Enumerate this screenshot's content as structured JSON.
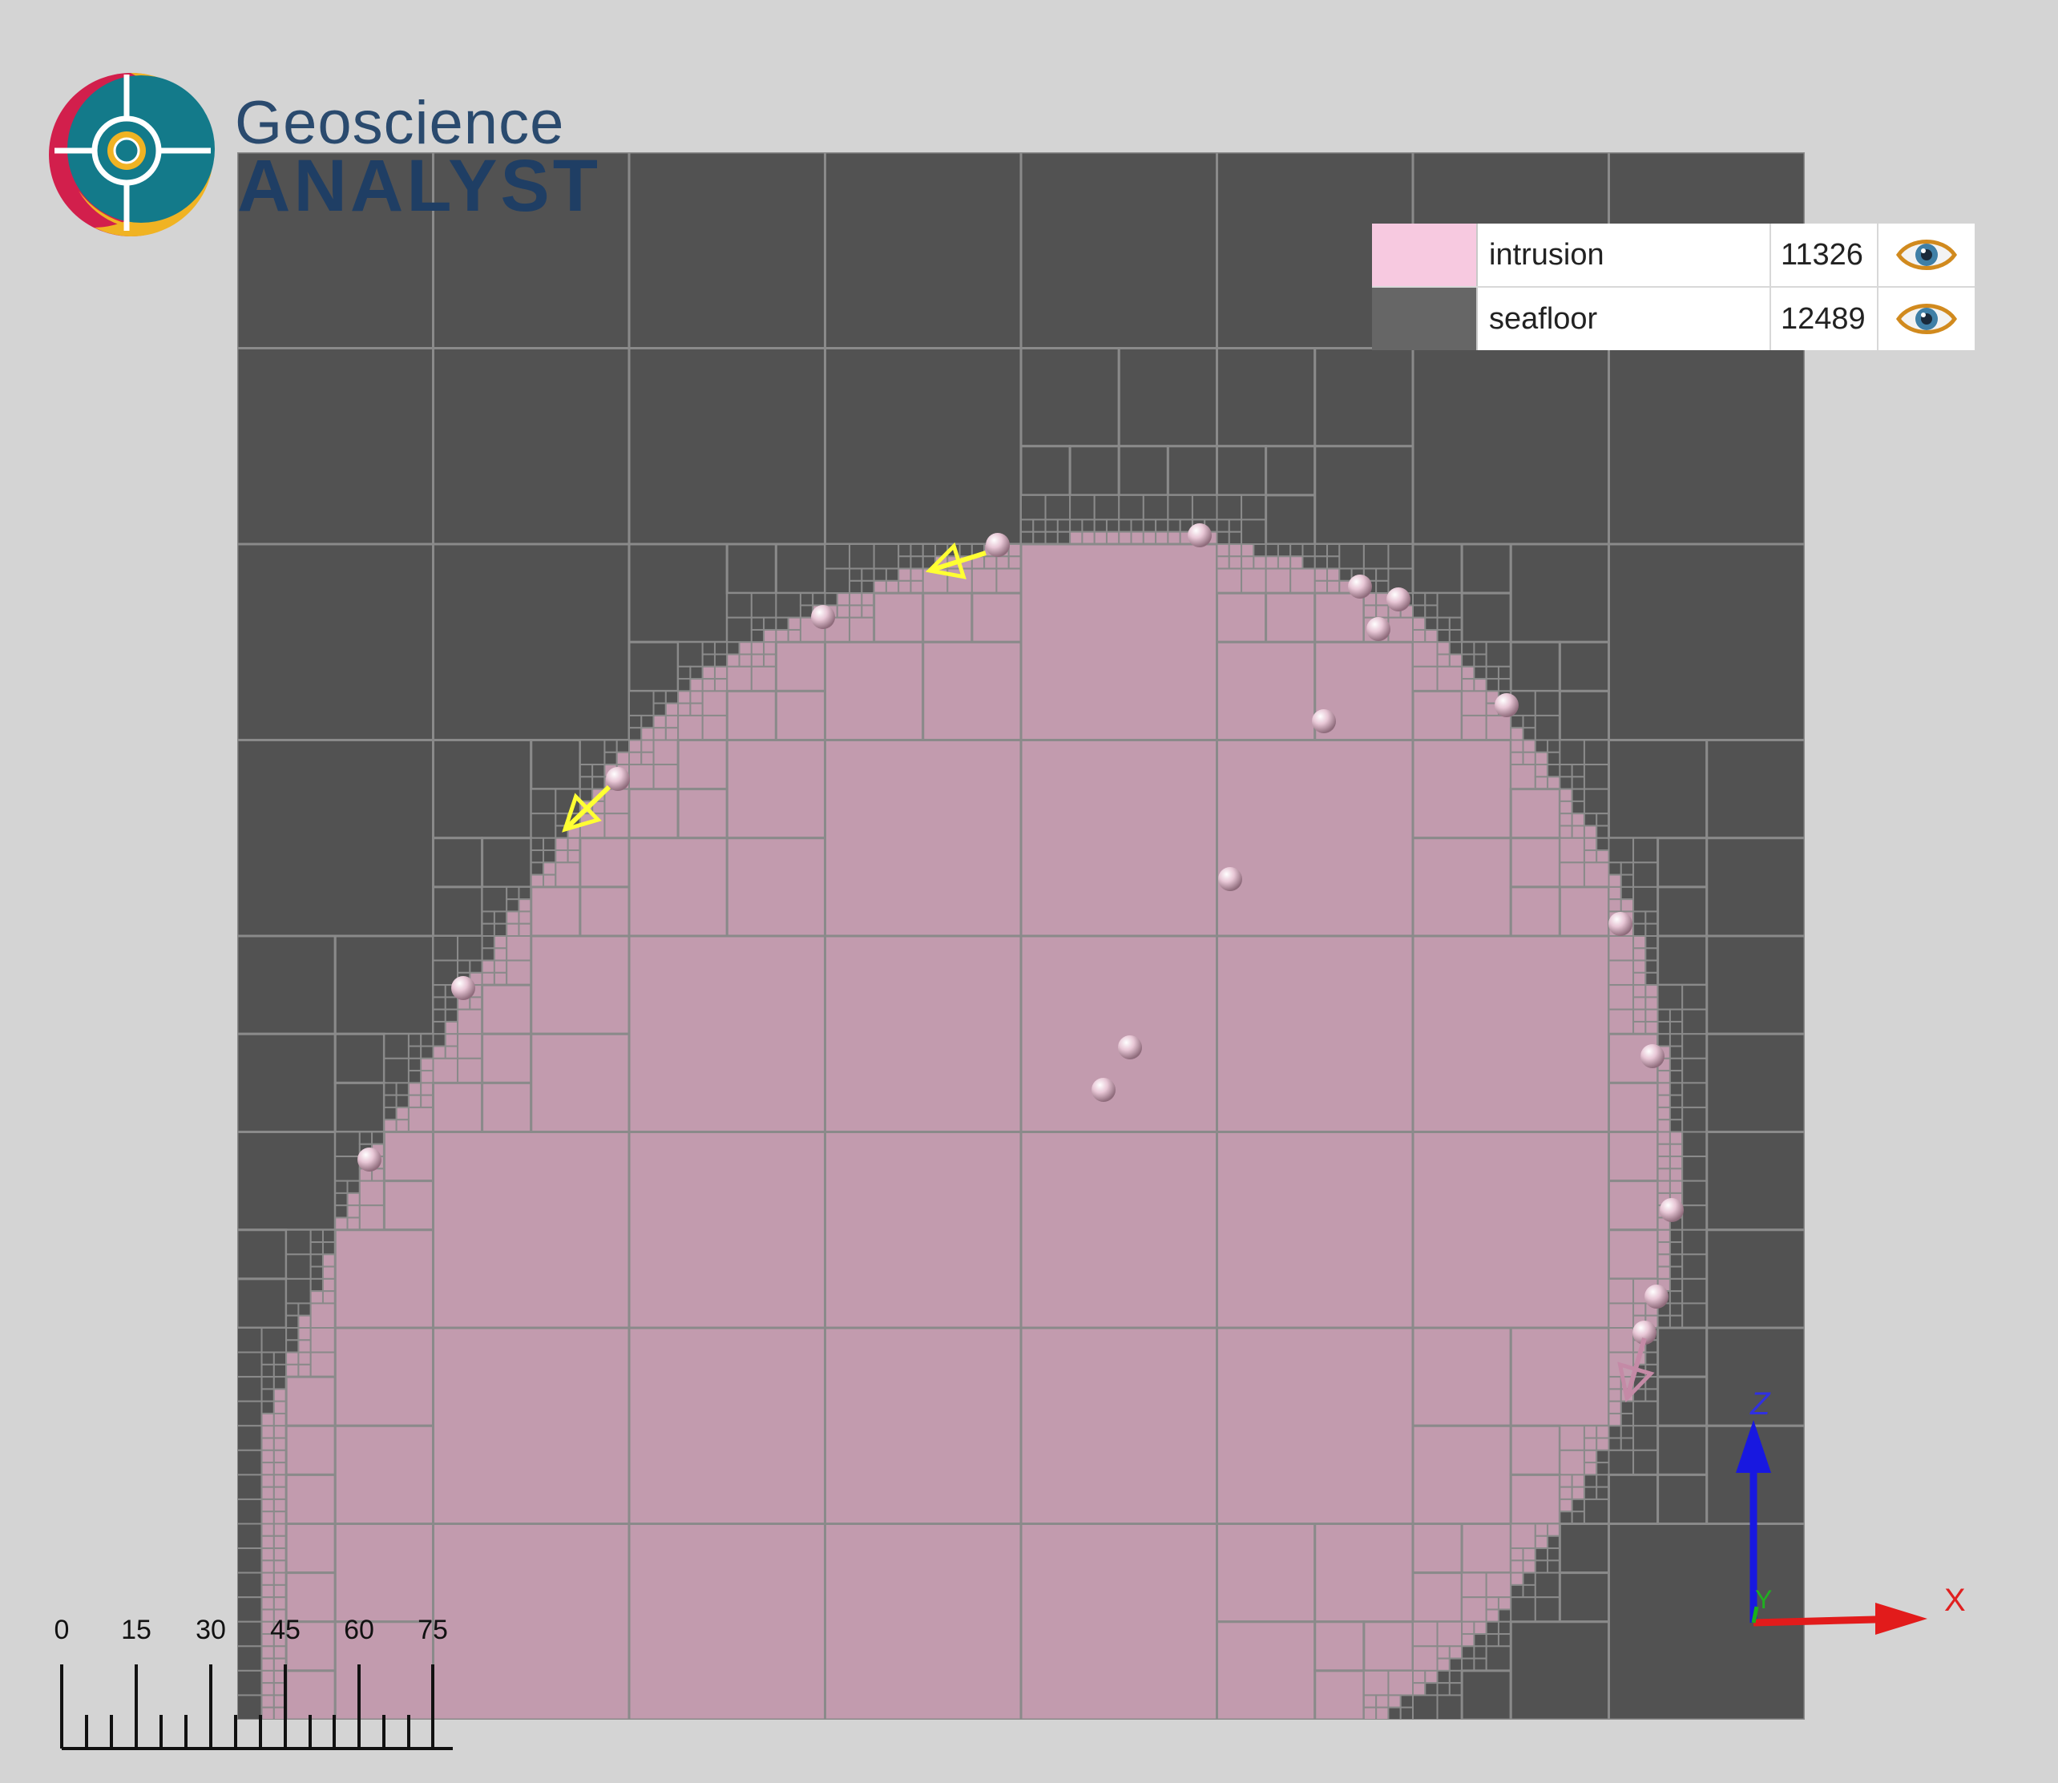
{
  "logo": {
    "line1": "Geoscience",
    "line2": "ANALYST"
  },
  "legend": {
    "items": [
      {
        "label": "intrusion",
        "count": "11326",
        "color": "#f7c9e0",
        "visible_icon": "eye-icon"
      },
      {
        "label": "seafloor",
        "count": "12489",
        "color": "#666666",
        "visible_icon": "eye-icon"
      }
    ]
  },
  "scale_bar": {
    "ticks": [
      "0",
      "15",
      "30",
      "45",
      "60",
      "75"
    ]
  },
  "axes": {
    "x": "X",
    "y": "Y",
    "z": "Z"
  },
  "colors": {
    "background": "#d4d4d4",
    "seafloor_block": "#525252",
    "intrusion_block": "#c29bae",
    "grid_line": "#8a8a8a",
    "marker": "#e2c3d2",
    "selected_arrow": "#ffff33",
    "x_axis": "#e21b1b",
    "z_axis": "#1818e0",
    "y_axis": "#1ab01a"
  }
}
